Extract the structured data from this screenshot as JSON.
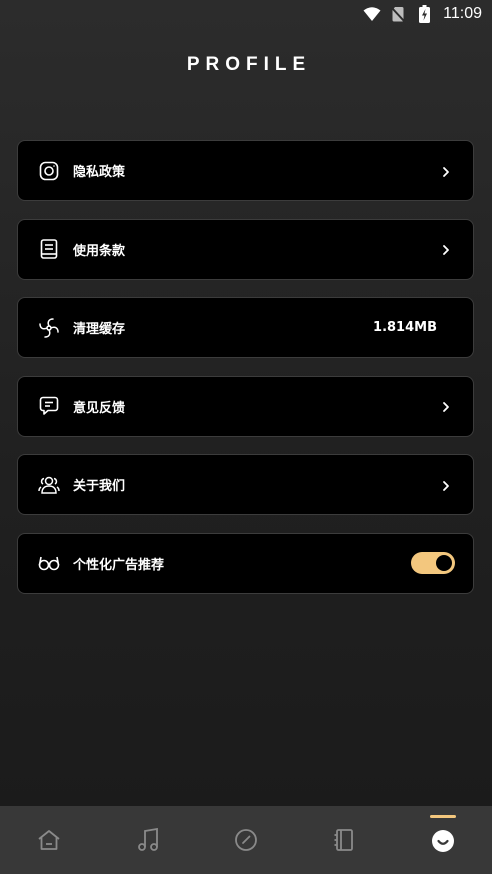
{
  "status_bar": {
    "time": "11:09",
    "icons": [
      "wifi-icon",
      "no-sim-icon",
      "battery-charging-icon"
    ]
  },
  "page": {
    "title": "PROFILE"
  },
  "menu": [
    {
      "label": "隐私政策",
      "icon": "privacy-icon",
      "trailing": "chevron"
    },
    {
      "label": "使用条款",
      "icon": "document-icon",
      "trailing": "chevron"
    },
    {
      "label": "清理缓存",
      "icon": "fan-icon",
      "trailing": "value",
      "value": "1.814MB"
    },
    {
      "label": "意见反馈",
      "icon": "feedback-icon",
      "trailing": "chevron"
    },
    {
      "label": "关于我们",
      "icon": "users-icon",
      "trailing": "chevron"
    },
    {
      "label": "个性化广告推荐",
      "icon": "glasses-icon",
      "trailing": "toggle",
      "toggle_on": true
    }
  ],
  "tab_bar": {
    "tabs": [
      {
        "icon": "home-icon",
        "active": false
      },
      {
        "icon": "music-note-icon",
        "active": false
      },
      {
        "icon": "compass-icon",
        "active": false
      },
      {
        "icon": "notebook-icon",
        "active": false
      },
      {
        "icon": "profile-face-icon",
        "active": true
      }
    ]
  },
  "colors": {
    "accent": "#f3c77e",
    "card_background": "#000000",
    "card_border": "#3c3c3c",
    "tab_bar_background": "#383838",
    "icon_inactive": "#8a8a8a"
  }
}
